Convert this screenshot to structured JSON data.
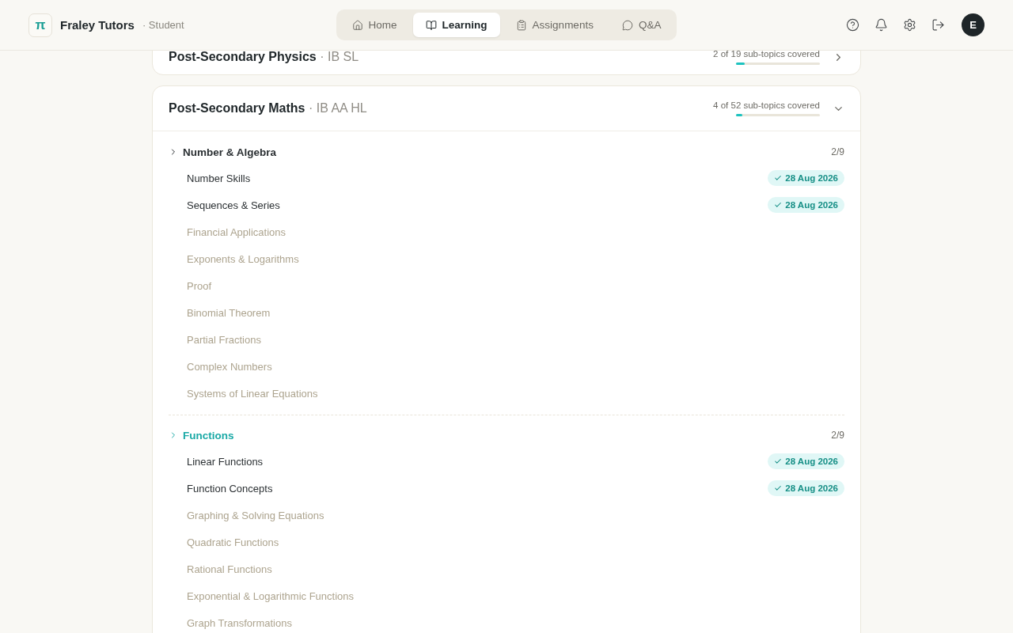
{
  "brand": {
    "logo": "π",
    "name": "Fraley Tutors",
    "role": "· Student"
  },
  "nav": [
    {
      "label": "Home",
      "selected": false
    },
    {
      "label": "Learning",
      "selected": true
    },
    {
      "label": "Assignments",
      "selected": false
    },
    {
      "label": "Q&A",
      "selected": false
    }
  ],
  "avatar": "E",
  "courses": [
    {
      "title": "Post-Secondary Physics",
      "level": "· IB SL",
      "covered": "2 of 19 sub-topics covered",
      "progress": {
        "level": 0.105
      },
      "expanded": false
    },
    {
      "title": "Post-Secondary Maths",
      "level": "· IB AA HL",
      "covered": "4 of 52 sub-topics covered",
      "progress": {
        "level": 0.077
      },
      "expanded": true,
      "groups": [
        {
          "name": "Number & Algebra",
          "count": "2/9",
          "highlighted": false,
          "topics": [
            {
              "name": "Number Skills",
              "covered": true,
              "date": "28 Aug 2026"
            },
            {
              "name": "Sequences & Series",
              "covered": true,
              "date": "28 Aug 2026"
            },
            {
              "name": "Financial Applications",
              "covered": false
            },
            {
              "name": "Exponents & Logarithms",
              "covered": false
            },
            {
              "name": "Proof",
              "covered": false
            },
            {
              "name": "Binomial Theorem",
              "covered": false
            },
            {
              "name": "Partial Fractions",
              "covered": false
            },
            {
              "name": "Complex Numbers",
              "covered": false
            },
            {
              "name": "Systems of Linear Equations",
              "covered": false
            }
          ]
        },
        {
          "name": "Functions",
          "count": "2/9",
          "highlighted": true,
          "topics": [
            {
              "name": "Linear Functions",
              "covered": true,
              "date": "28 Aug 2026"
            },
            {
              "name": "Function Concepts",
              "covered": true,
              "date": "28 Aug 2026"
            },
            {
              "name": "Graphing & Solving Equations",
              "covered": false
            },
            {
              "name": "Quadratic Functions",
              "covered": false
            },
            {
              "name": "Rational Functions",
              "covered": false
            },
            {
              "name": "Exponential & Logarithmic Functions",
              "covered": false
            },
            {
              "name": "Graph Transformations",
              "covered": false
            }
          ]
        }
      ]
    }
  ]
}
